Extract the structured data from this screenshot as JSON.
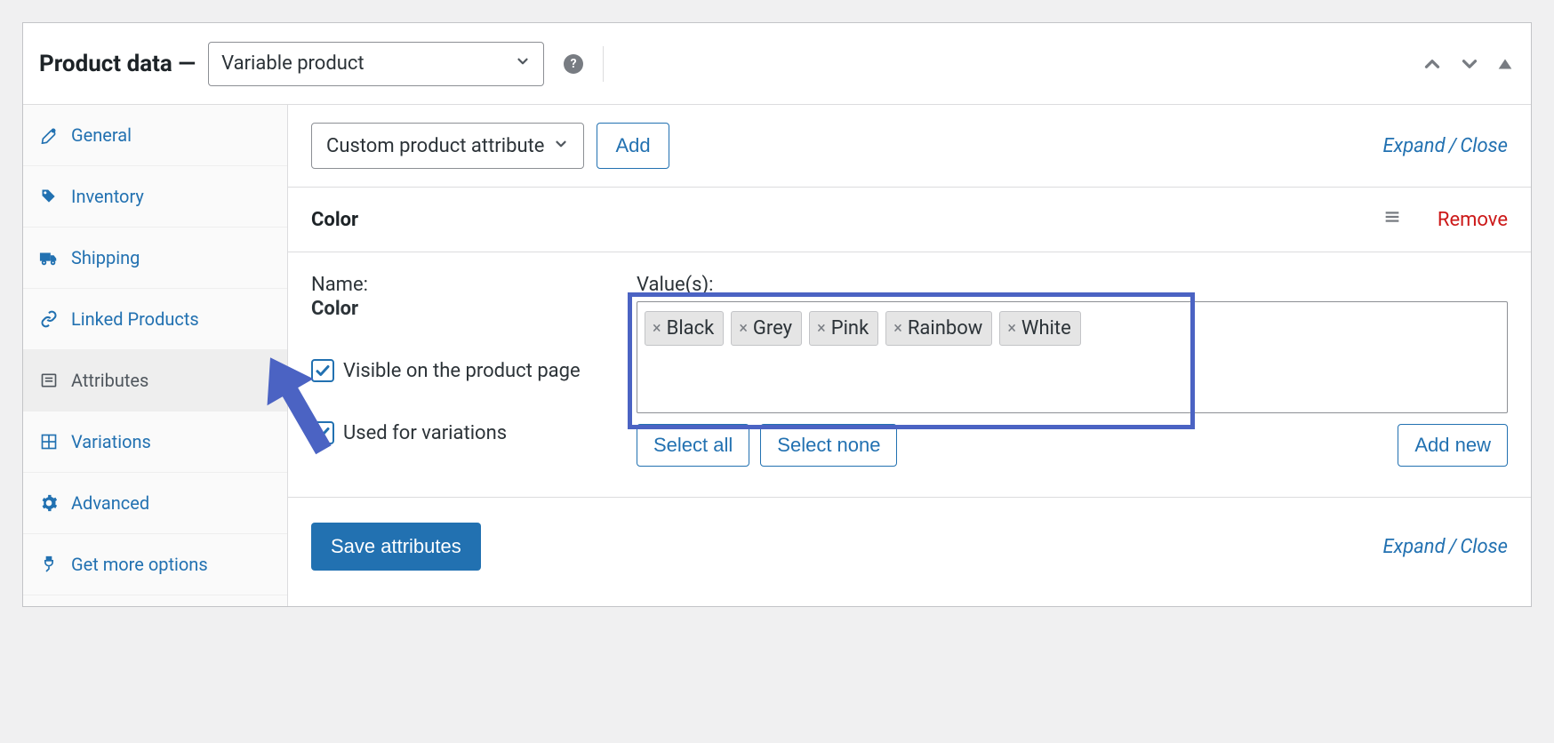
{
  "header": {
    "title": "Product data —",
    "product_type": "Variable product"
  },
  "sidebar": {
    "items": [
      {
        "label": "General"
      },
      {
        "label": "Inventory"
      },
      {
        "label": "Shipping"
      },
      {
        "label": "Linked Products"
      },
      {
        "label": "Attributes"
      },
      {
        "label": "Variations"
      },
      {
        "label": "Advanced"
      },
      {
        "label": "Get more options"
      }
    ]
  },
  "content": {
    "attribute_select": "Custom product attribute",
    "add_button": "Add",
    "expand_label": "Expand",
    "close_label": "Close",
    "attribute": {
      "title": "Color",
      "remove": "Remove",
      "name_label": "Name:",
      "name_value": "Color",
      "visible_label": "Visible on the product page",
      "used_label": "Used for variations",
      "values_label": "Value(s):",
      "values": [
        "Black",
        "Grey",
        "Pink",
        "Rainbow",
        "White"
      ],
      "select_all": "Select all",
      "select_none": "Select none",
      "add_new": "Add new"
    },
    "save_button": "Save attributes"
  }
}
